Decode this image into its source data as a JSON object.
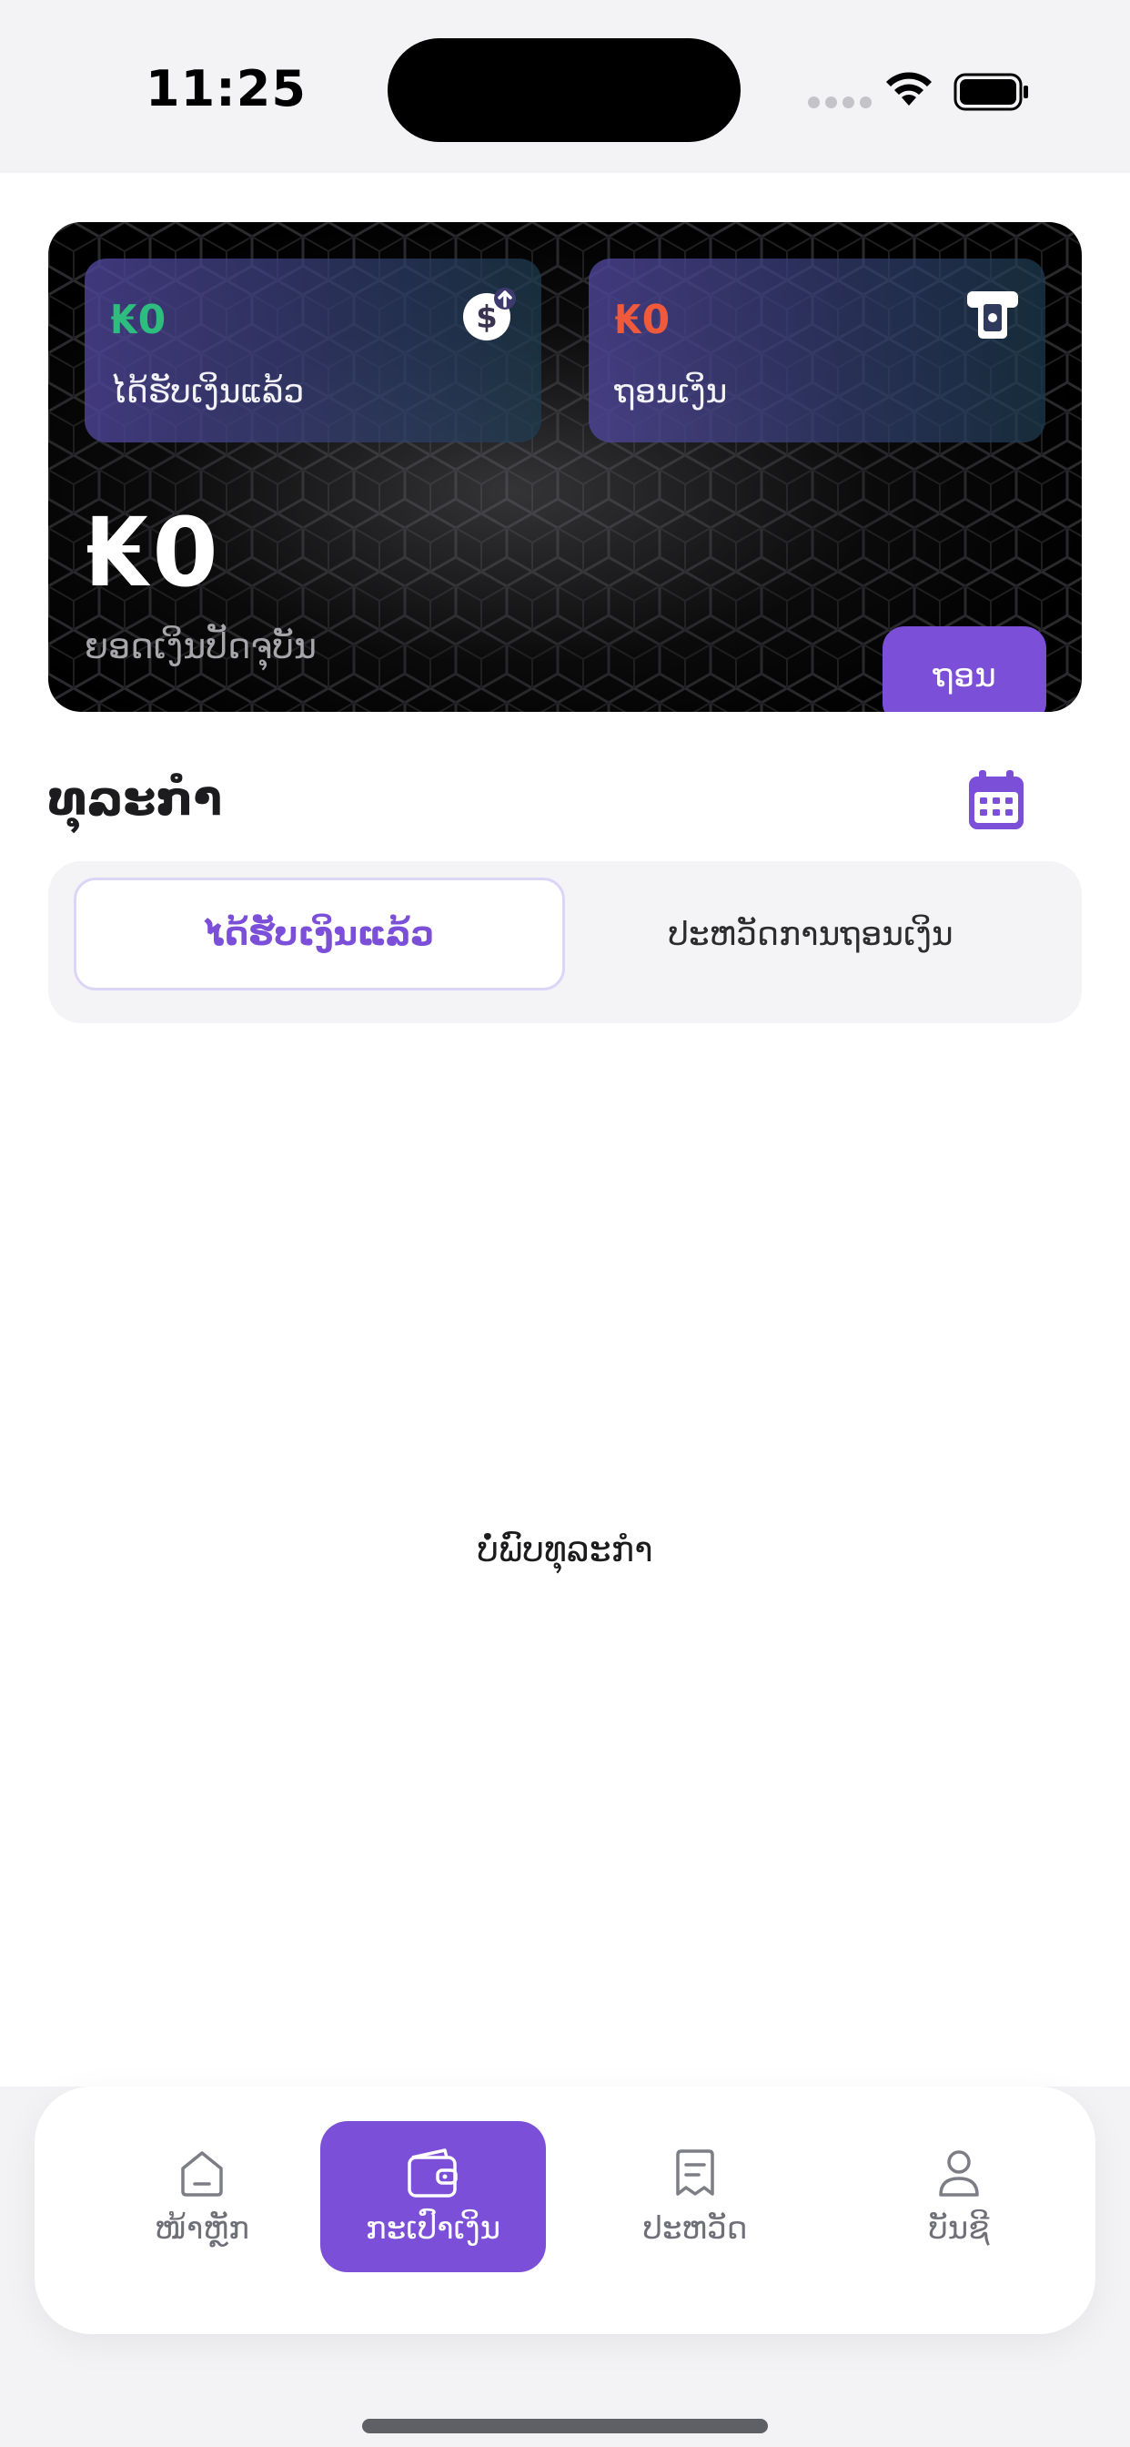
{
  "status_bar": {
    "time": "11:25"
  },
  "wallet": {
    "received": {
      "amount": "₭0",
      "label": "ໄດ້ຮັບເງິນແລ້ວ",
      "icon": "dollar-up-icon"
    },
    "withdrawn": {
      "amount": "₭0",
      "label": "ຖອນເງິນ",
      "icon": "atm-withdraw-icon"
    },
    "balance": {
      "amount": "₭0",
      "label": "ຍອດເງິນປັດຈຸບັນ"
    },
    "withdraw_button": "ຖອນ"
  },
  "transactions": {
    "title": "ທຸລະກຳ",
    "calendar_icon": "calendar-icon",
    "tabs": [
      {
        "label": "ໄດ້ຮັບເງິນແລ້ວ",
        "active": true
      },
      {
        "label": "ປະຫວັດການຖອນເງິນ",
        "active": false
      }
    ],
    "empty_message": "ບໍ່ພົບທຸລະກຳ"
  },
  "tabbar": {
    "items": [
      {
        "label": "ໜ້າຫຼັກ",
        "icon": "home-icon",
        "active": false
      },
      {
        "label": "ກະເປົາເງິນ",
        "icon": "wallet-icon",
        "active": true
      },
      {
        "label": "ປະຫວັດ",
        "icon": "history-icon",
        "active": false
      },
      {
        "label": "ບັນຊີ",
        "icon": "account-icon",
        "active": false
      }
    ]
  },
  "colors": {
    "accent": "#7b4fd8",
    "received": "#2dbd7e",
    "withdrawn": "#ef5a3c",
    "card_background": "#000000"
  }
}
